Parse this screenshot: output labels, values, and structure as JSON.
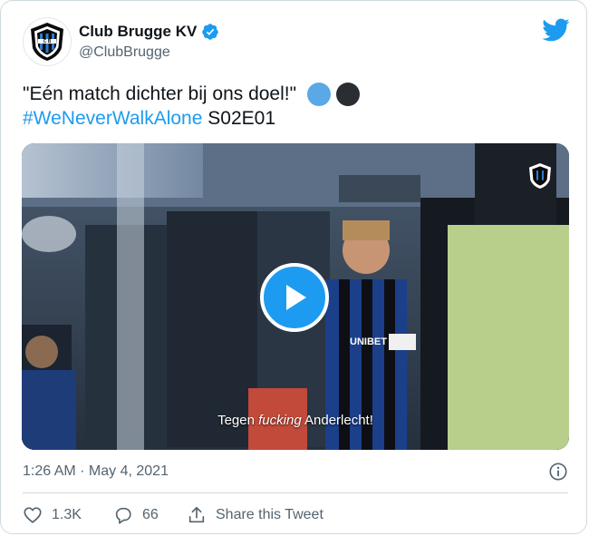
{
  "account": {
    "display_name": "Club Brugge KV",
    "handle": "@ClubBrugge",
    "verified": true,
    "logo_letters": "C B"
  },
  "tweet": {
    "text_line1": "\"Eén match dichter bij ons doel!\"",
    "hashtag": "#WeNeverWalkAlone",
    "episode": "S02E01",
    "emojis": [
      "blue-circle-emoji",
      "black-circle-emoji"
    ]
  },
  "video": {
    "subtitle_before": "Tegen ",
    "subtitle_italic": "fucking",
    "subtitle_after": " Anderlecht!",
    "jersey_text": "UNIBET"
  },
  "meta": {
    "timestamp": "1:26 AM · May 4, 2021"
  },
  "actions": {
    "likes": "1.3K",
    "replies": "66",
    "share_label": "Share this Tweet"
  },
  "colors": {
    "accent": "#1d9bf0",
    "text": "#0f1419",
    "secondary": "#536471",
    "border": "#cfd9de"
  }
}
